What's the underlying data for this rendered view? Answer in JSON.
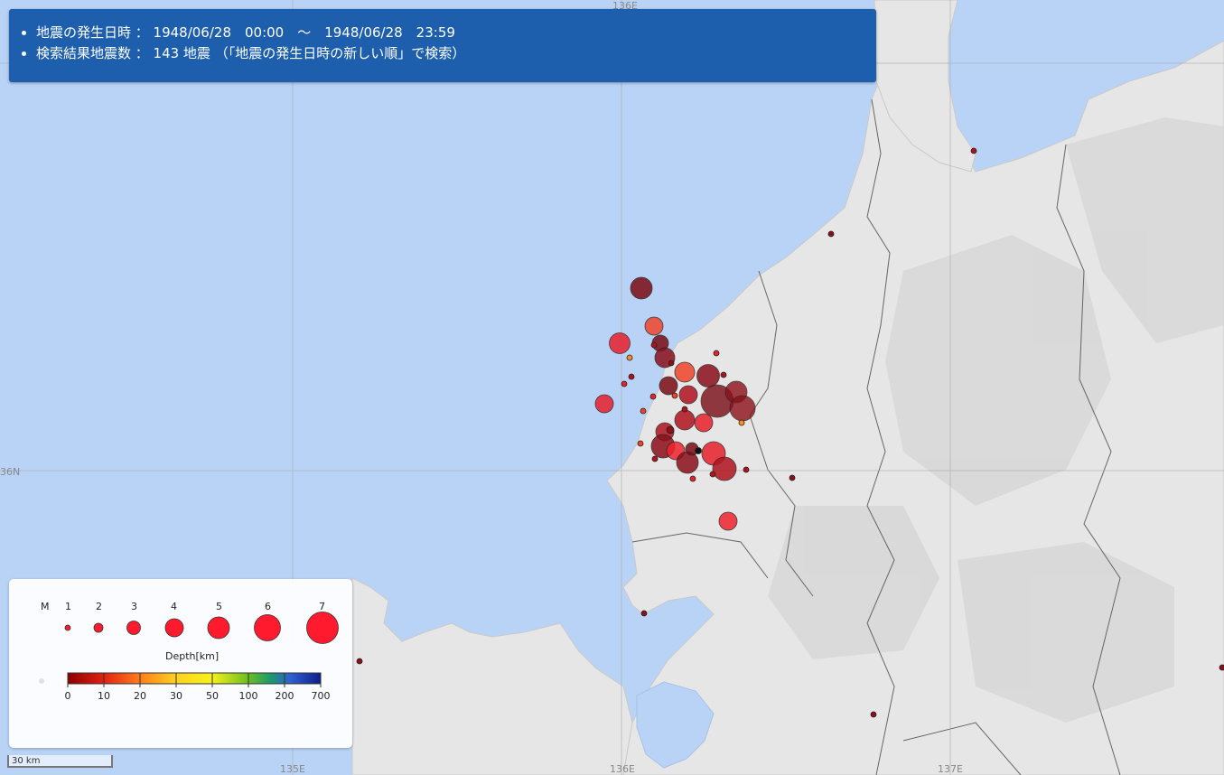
{
  "info": {
    "line1": "地震の発生日時 ： 1948/06/28　00:00　～　1948/06/28　23:59",
    "line2": "検索結果地震数 ： 143 地震 （「地震の発生日時の新しい順」で検索）"
  },
  "grid_labels": {
    "lon_135": "135E",
    "lon_136": "136E",
    "lon_137": "137E",
    "lat_36": "36N"
  },
  "legend": {
    "m_label": "M",
    "magnitudes": [
      "1",
      "2",
      "3",
      "4",
      "5",
      "6",
      "7"
    ],
    "depth_title": "Depth[km]",
    "depth_ticks": [
      "0",
      "10",
      "20",
      "30",
      "50",
      "100",
      "200",
      "700"
    ],
    "depth_colors": [
      "#8b0000",
      "#e02010",
      "#ff7a1a",
      "#ffd21e",
      "#f6f21a",
      "#6fc01e",
      "#1e9a6a",
      "#2f5fd0",
      "#101c8a"
    ],
    "marker_color": "#ff1a2e"
  },
  "scale": {
    "label": "30 km"
  },
  "colors": {
    "sea": "#b9d3f7",
    "land": "#ececec",
    "info_bg": "#1d5fad"
  }
}
